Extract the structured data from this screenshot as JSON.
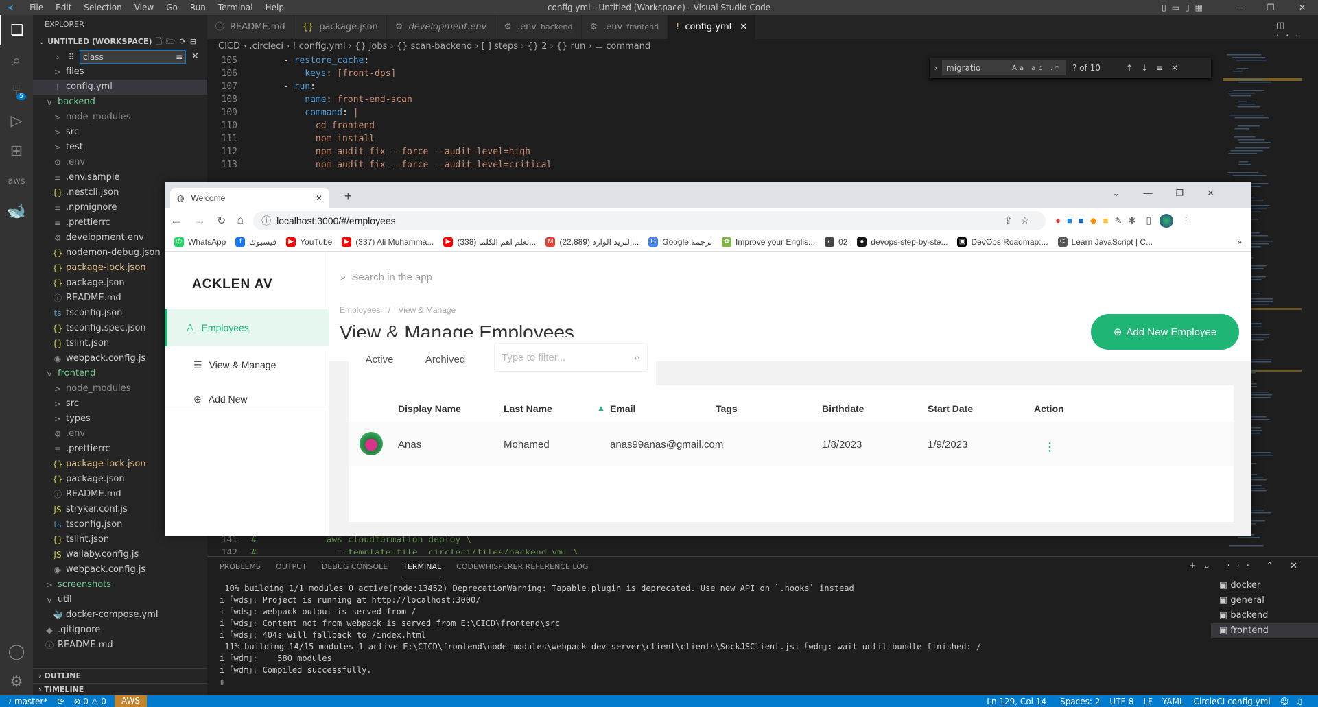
{
  "window": {
    "title": "config.yml - Untitled (Workspace) - Visual Studio Code",
    "menu": [
      "File",
      "Edit",
      "Selection",
      "View",
      "Go",
      "Run",
      "Terminal",
      "Help"
    ]
  },
  "explorer": {
    "header": "EXPLORER",
    "workspace": "UNTITLED (WORKSPACE)",
    "filter_value": "class",
    "items": [
      {
        "label": "files",
        "icon": ">",
        "indent": 1,
        "color": "#cccccc"
      },
      {
        "label": "config.yml",
        "icon": "!",
        "indent": 1,
        "color": "#cccccc",
        "selected": true
      },
      {
        "label": "backend",
        "icon": "v",
        "indent": 0,
        "color": "#73c991"
      },
      {
        "label": "node_modules",
        "icon": ">",
        "indent": 1,
        "color": "#8c8c8c"
      },
      {
        "label": "src",
        "icon": ">",
        "indent": 1,
        "color": "#cccccc"
      },
      {
        "label": "test",
        "icon": ">",
        "indent": 1,
        "color": "#cccccc"
      },
      {
        "label": ".env",
        "icon": "⚙",
        "indent": 1,
        "color": "#8c8c8c"
      },
      {
        "label": ".env.sample",
        "icon": "≡",
        "indent": 1,
        "color": "#cccccc"
      },
      {
        "label": ".nestcli.json",
        "icon": "{}",
        "indent": 1,
        "color": "#cccccc"
      },
      {
        "label": ".npmignore",
        "icon": "≡",
        "indent": 1,
        "color": "#cccccc"
      },
      {
        "label": ".prettierrc",
        "icon": "≡",
        "indent": 1,
        "color": "#cccccc"
      },
      {
        "label": "development.env",
        "icon": "⚙",
        "indent": 1,
        "color": "#cccccc"
      },
      {
        "label": "nodemon-debug.json",
        "icon": "{}",
        "indent": 1,
        "color": "#cccccc"
      },
      {
        "label": "package-lock.json",
        "icon": "{}",
        "indent": 1,
        "color": "#e2c08d"
      },
      {
        "label": "package.json",
        "icon": "{}",
        "indent": 1,
        "color": "#cccccc"
      },
      {
        "label": "README.md",
        "icon": "ⓘ",
        "indent": 1,
        "color": "#cccccc"
      },
      {
        "label": "tsconfig.json",
        "icon": "ts",
        "indent": 1,
        "color": "#cccccc"
      },
      {
        "label": "tsconfig.spec.json",
        "icon": "{}",
        "indent": 1,
        "color": "#cccccc"
      },
      {
        "label": "tslint.json",
        "icon": "{}",
        "indent": 1,
        "color": "#cccccc"
      },
      {
        "label": "webpack.config.js",
        "icon": "◉",
        "indent": 1,
        "color": "#cccccc"
      },
      {
        "label": "frontend",
        "icon": "v",
        "indent": 0,
        "color": "#73c991"
      },
      {
        "label": "node_modules",
        "icon": ">",
        "indent": 1,
        "color": "#8c8c8c"
      },
      {
        "label": "src",
        "icon": ">",
        "indent": 1,
        "color": "#cccccc"
      },
      {
        "label": "types",
        "icon": ">",
        "indent": 1,
        "color": "#cccccc"
      },
      {
        "label": ".env",
        "icon": "⚙",
        "indent": 1,
        "color": "#8c8c8c"
      },
      {
        "label": ".prettierrc",
        "icon": "≡",
        "indent": 1,
        "color": "#cccccc"
      },
      {
        "label": "package-lock.json",
        "icon": "{}",
        "indent": 1,
        "color": "#e2c08d"
      },
      {
        "label": "package.json",
        "icon": "{}",
        "indent": 1,
        "color": "#cccccc"
      },
      {
        "label": "README.md",
        "icon": "ⓘ",
        "indent": 1,
        "color": "#cccccc"
      },
      {
        "label": "stryker.conf.js",
        "icon": "JS",
        "indent": 1,
        "color": "#cccccc"
      },
      {
        "label": "tsconfig.json",
        "icon": "ts",
        "indent": 1,
        "color": "#cccccc"
      },
      {
        "label": "tslint.json",
        "icon": "{}",
        "indent": 1,
        "color": "#cccccc"
      },
      {
        "label": "wallaby.config.js",
        "icon": "JS",
        "indent": 1,
        "color": "#cccccc"
      },
      {
        "label": "webpack.config.js",
        "icon": "◉",
        "indent": 1,
        "color": "#cccccc"
      },
      {
        "label": "screenshots",
        "icon": ">",
        "indent": 0,
        "color": "#73c991"
      },
      {
        "label": "util",
        "icon": "v",
        "indent": 0,
        "color": "#cccccc"
      },
      {
        "label": "docker-compose.yml",
        "icon": "🐳",
        "indent": 1,
        "color": "#cccccc"
      },
      {
        "label": ".gitignore",
        "icon": "◆",
        "indent": 0,
        "color": "#cccccc"
      },
      {
        "label": "README.md",
        "icon": "ⓘ",
        "indent": 0,
        "color": "#cccccc"
      }
    ],
    "outline": "OUTLINE",
    "timeline": "TIMELINE"
  },
  "editor_tabs": [
    {
      "label": "README.md",
      "icon": "ⓘ"
    },
    {
      "label": "package.json",
      "icon": "{}"
    },
    {
      "label": "development.env",
      "icon": "⚙"
    },
    {
      "label": ".env",
      "icon": "⚙",
      "desc": "backend"
    },
    {
      "label": ".env",
      "icon": "⚙",
      "desc": "frontend"
    },
    {
      "label": "config.yml",
      "icon": "!",
      "active": true
    }
  ],
  "breadcrumb": "CICD › .circleci › ! config.yml › {} jobs › {} scan-backend › [ ] steps › {} 2 › {} run › ▭ command",
  "code_lines": [
    {
      "n": "105",
      "t": "      - restore_cache:"
    },
    {
      "n": "106",
      "t": "          keys: [front-dps]"
    },
    {
      "n": "107",
      "t": "      - run:"
    },
    {
      "n": "108",
      "t": "          name: front-end-scan"
    },
    {
      "n": "109",
      "t": "          command: |"
    },
    {
      "n": "110",
      "t": "            cd frontend"
    },
    {
      "n": "111",
      "t": "            npm install"
    },
    {
      "n": "112",
      "t": "            npm audit fix --force --audit-level=high"
    },
    {
      "n": "113",
      "t": "            npm audit fix --force --audit-level=critical"
    }
  ],
  "code_lines_bottom": [
    {
      "n": "141",
      "t": "#             aws cloudformation deploy \\"
    },
    {
      "n": "142",
      "t": "#               --template-file .circleci/files/backend.yml \\"
    }
  ],
  "find": {
    "value": "migratio",
    "match_case": "Aa",
    "whole_word": "ab",
    "regex": ".*",
    "count": "? of 10"
  },
  "panel": {
    "tabs": [
      "PROBLEMS",
      "OUTPUT",
      "DEBUG CONSOLE",
      "TERMINAL",
      "CODEWHISPERER REFERENCE LOG"
    ],
    "active_tab": "TERMINAL",
    "lines": [
      " 10% building 1/1 modules 0 active(node:13452) DeprecationWarning: Tapable.plugin is deprecated. Use new API on `.hooks` instead",
      "i ｢wds｣: Project is running at http://localhost:3000/",
      "i ｢wds｣: webpack output is served from /",
      "i ｢wds｣: Content not from webpack is served from E:\\CICD\\frontend\\src",
      "i ｢wds｣: 404s will fallback to /index.html",
      " 11% building 14/15 modules 1 active E:\\CICD\\frontend\\node_modules\\webpack-dev-server\\client\\clients\\SockJSClient.jsi ｢wdm｣: wait until bundle finished: /",
      "i ｢wdm｣:    580 modules",
      "i ｢wdm｣: Compiled successfully."
    ],
    "terminals": [
      "docker",
      "general",
      "backend",
      "frontend"
    ],
    "active_terminal": "frontend"
  },
  "status": {
    "branch": "master*",
    "sync": "⟳",
    "problems": "⊗ 0 ⚠ 0",
    "aws": "AWS",
    "position": "Ln 129, Col 14",
    "spaces": "Spaces: 2",
    "encoding": "UTF-8",
    "eol": "LF",
    "language": "YAML",
    "schema": "CircleCI config.yml"
  },
  "browser": {
    "tab_title": "Welcome",
    "url": "localhost:3000/#/employees",
    "bookmarks": [
      {
        "label": "WhatsApp",
        "color": "#25d366",
        "glyph": "✆"
      },
      {
        "label": "فيسبوك",
        "color": "#1877f2",
        "glyph": "f"
      },
      {
        "label": "YouTube",
        "color": "#ff0000",
        "glyph": "▶"
      },
      {
        "label": "(337) Ali Muhamma...",
        "color": "#ff0000",
        "glyph": "▶"
      },
      {
        "label": "(338) تعلم اهم الكلما...",
        "color": "#ff0000",
        "glyph": "▶"
      },
      {
        "label": "البريد الوارد (22,889)...",
        "color": "#ea4335",
        "glyph": "M"
      },
      {
        "label": "Google ترجمة",
        "color": "#4285f4",
        "glyph": "G"
      },
      {
        "label": "Improve your Englis...",
        "color": "#7cb342",
        "glyph": "✿"
      },
      {
        "label": "02",
        "color": "#444444",
        "glyph": "◐"
      },
      {
        "label": "devops-step-by-ste...",
        "color": "#181717",
        "glyph": "●"
      },
      {
        "label": "DevOps Roadmap:...",
        "color": "#000000",
        "glyph": "▣"
      },
      {
        "label": "Learn JavaScript | C...",
        "color": "#555555",
        "glyph": "C"
      }
    ]
  },
  "app": {
    "logo": "ACKLEN AV",
    "search_placeholder": "Search in the app",
    "nav": [
      {
        "label": "Employees",
        "icon": "person-icon",
        "active": true
      },
      {
        "label": "View & Manage",
        "icon": "list-icon"
      },
      {
        "label": "Add New",
        "icon": "plus-circle-icon"
      }
    ],
    "breadcrumb": [
      "Employees",
      "View & Manage"
    ],
    "page_title": "View & Manage Employees",
    "add_button": "Add New Employee",
    "tabs": [
      "Active",
      "Archived"
    ],
    "filter_placeholder": "Type to filter...",
    "columns": [
      "Display Name",
      "Last Name",
      "Email",
      "Tags",
      "Birthdate",
      "Start Date",
      "Action"
    ],
    "rows": [
      {
        "display_name": "Anas",
        "last_name": "Mohamed",
        "email": "anas99anas@gmail.com",
        "tags": "",
        "birthdate": "1/8/2023",
        "start_date": "1/9/2023"
      }
    ],
    "brand_color": "#1fb575"
  }
}
